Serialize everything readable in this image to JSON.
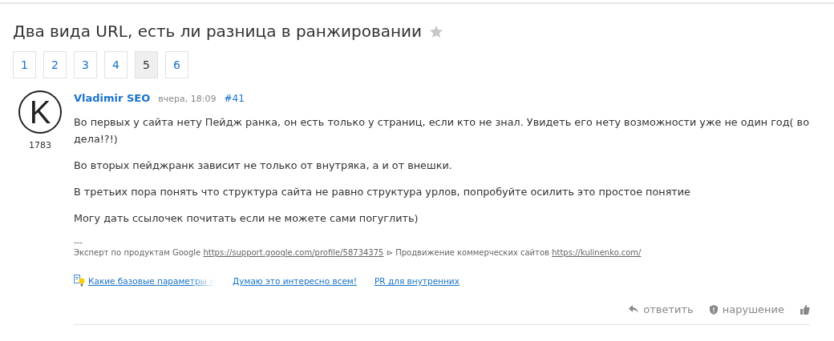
{
  "title": "Два вида URL, есть ли разница в ранжировании",
  "favorite": {
    "on": false
  },
  "pagination": [
    {
      "label": "1",
      "selected": false
    },
    {
      "label": "2",
      "selected": false
    },
    {
      "label": "3",
      "selected": false
    },
    {
      "label": "4",
      "selected": false
    },
    {
      "label": "5",
      "selected": true
    },
    {
      "label": "6",
      "selected": false
    }
  ],
  "post": {
    "avatar_letter": "K",
    "rating": "1783",
    "author": "Vladimir SEO",
    "time": "вчера, 18:09",
    "number": "#41",
    "paragraphs": [
      "Во первых у сайта нету Пейдж ранка, он есть только у страниц, если кто не знал. Увидеть его нету возможности уже не один год( во дела!?!)",
      "Во вторых пейджранк зависит не только от внутряка, а и от внешки.",
      "В третьих пора понять что структура сайта не равно структура урлов, попробуйте осилить это простое понятие",
      "Могу дать ссылочек почитать если не можете сами погуглить)"
    ],
    "signature": {
      "separator": "---",
      "text_1": "Эксперт по продуктам Google",
      "link_1": "https://support.google.com/profile/58734375",
      "arrow": "⊳",
      "text_2": "Продвижение коммерческих сайтов",
      "link_2": "https://kulinenko.com/"
    },
    "related": [
      "Какие базовые параметры и",
      "Думаю это интересно всем!",
      "PR для внутренних"
    ],
    "actions": [
      {
        "kind": "reply",
        "label": "ответить"
      },
      {
        "kind": "report",
        "label": "нарушение"
      },
      {
        "kind": "like"
      }
    ]
  }
}
